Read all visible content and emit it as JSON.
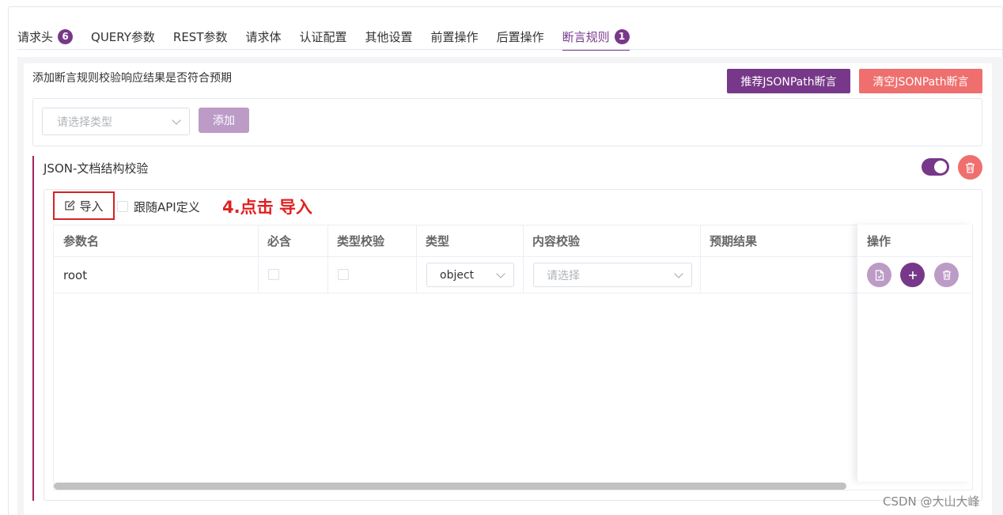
{
  "tabs": [
    {
      "label": "请求头",
      "badge": "6"
    },
    {
      "label": "QUERY参数"
    },
    {
      "label": "REST参数"
    },
    {
      "label": "请求体"
    },
    {
      "label": "认证配置"
    },
    {
      "label": "其他设置"
    },
    {
      "label": "前置操作"
    },
    {
      "label": "后置操作"
    },
    {
      "label": "断言规则",
      "badge": "1",
      "active": true
    }
  ],
  "assert": {
    "description": "添加断言规则校验响应结果是否符合预期",
    "recommend_button": "推荐JSONPath断言",
    "clear_button": "清空JSONPath断言",
    "type_select_placeholder": "请选择类型",
    "add_button": "添加"
  },
  "rule": {
    "title": "JSON-文档结构校验",
    "enabled": true,
    "import_label": "导入",
    "follow_api_label": "跟随API定义",
    "annotation": "4.点击 导入"
  },
  "table": {
    "headers": [
      "参数名",
      "必含",
      "类型校验",
      "类型",
      "内容校验",
      "预期结果",
      "操作"
    ],
    "rows": [
      {
        "name": "root",
        "required": false,
        "type_check": false,
        "type": "object",
        "content_check_placeholder": "请选择",
        "expected": ""
      }
    ]
  },
  "colors": {
    "accent": "#783889",
    "danger": "#ef6f6f",
    "annotation": "#e02020"
  },
  "watermark": "CSDN @大山大峰"
}
